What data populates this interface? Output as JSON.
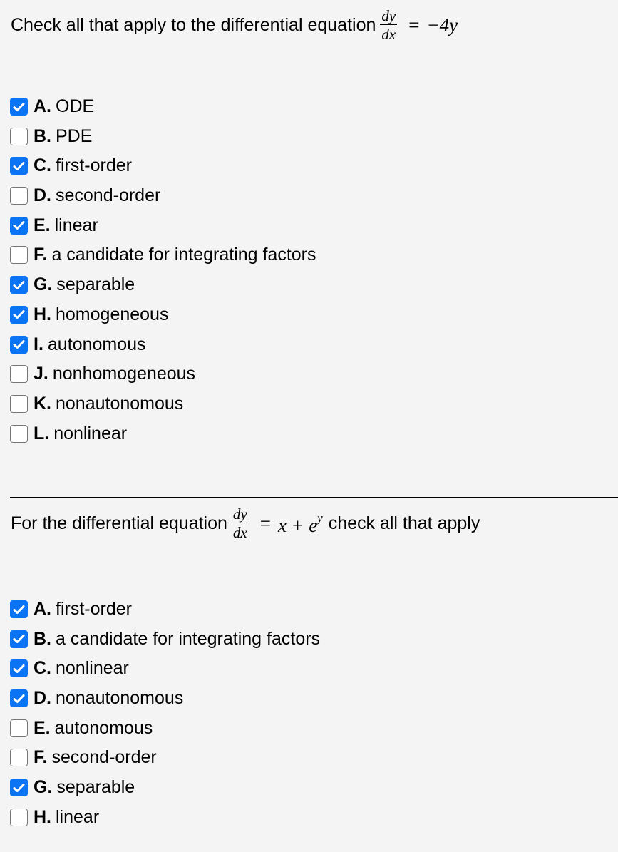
{
  "question1": {
    "prompt_before": "Check all that apply to the differential equation",
    "equation": {
      "numerator": "dy",
      "denominator": "dx",
      "relation": "=",
      "rhs": "−4y"
    },
    "options": [
      {
        "letter": "A.",
        "label": "ODE",
        "checked": true
      },
      {
        "letter": "B.",
        "label": "PDE",
        "checked": false
      },
      {
        "letter": "C.",
        "label": "first-order",
        "checked": true
      },
      {
        "letter": "D.",
        "label": "second-order",
        "checked": false
      },
      {
        "letter": "E.",
        "label": "linear",
        "checked": true
      },
      {
        "letter": "F.",
        "label": "a candidate for integrating factors",
        "checked": false
      },
      {
        "letter": "G.",
        "label": "separable",
        "checked": true
      },
      {
        "letter": "H.",
        "label": "homogeneous",
        "checked": true
      },
      {
        "letter": "I.",
        "label": "autonomous",
        "checked": true
      },
      {
        "letter": "J.",
        "label": "nonhomogeneous",
        "checked": false
      },
      {
        "letter": "K.",
        "label": "nonautonomous",
        "checked": false
      },
      {
        "letter": "L.",
        "label": "nonlinear",
        "checked": false
      }
    ]
  },
  "question2": {
    "prompt_before": "For the differential equation",
    "equation": {
      "numerator": "dy",
      "denominator": "dx",
      "relation": "=",
      "rhs_x": "x",
      "rhs_op": "+",
      "rhs_base": "e",
      "rhs_exp": "y"
    },
    "prompt_after": "check all that apply",
    "options": [
      {
        "letter": "A.",
        "label": "first-order",
        "checked": true
      },
      {
        "letter": "B.",
        "label": "a candidate for integrating factors",
        "checked": true
      },
      {
        "letter": "C.",
        "label": "nonlinear",
        "checked": true
      },
      {
        "letter": "D.",
        "label": "nonautonomous",
        "checked": true
      },
      {
        "letter": "E.",
        "label": "autonomous",
        "checked": false
      },
      {
        "letter": "F.",
        "label": "second-order",
        "checked": false
      },
      {
        "letter": "G.",
        "label": "separable",
        "checked": true
      },
      {
        "letter": "H.",
        "label": "linear",
        "checked": false
      }
    ]
  },
  "colors": {
    "checkbox_checked": "#0b74f5",
    "checkbox_border": "#767676",
    "background": "#f4f4f4"
  }
}
